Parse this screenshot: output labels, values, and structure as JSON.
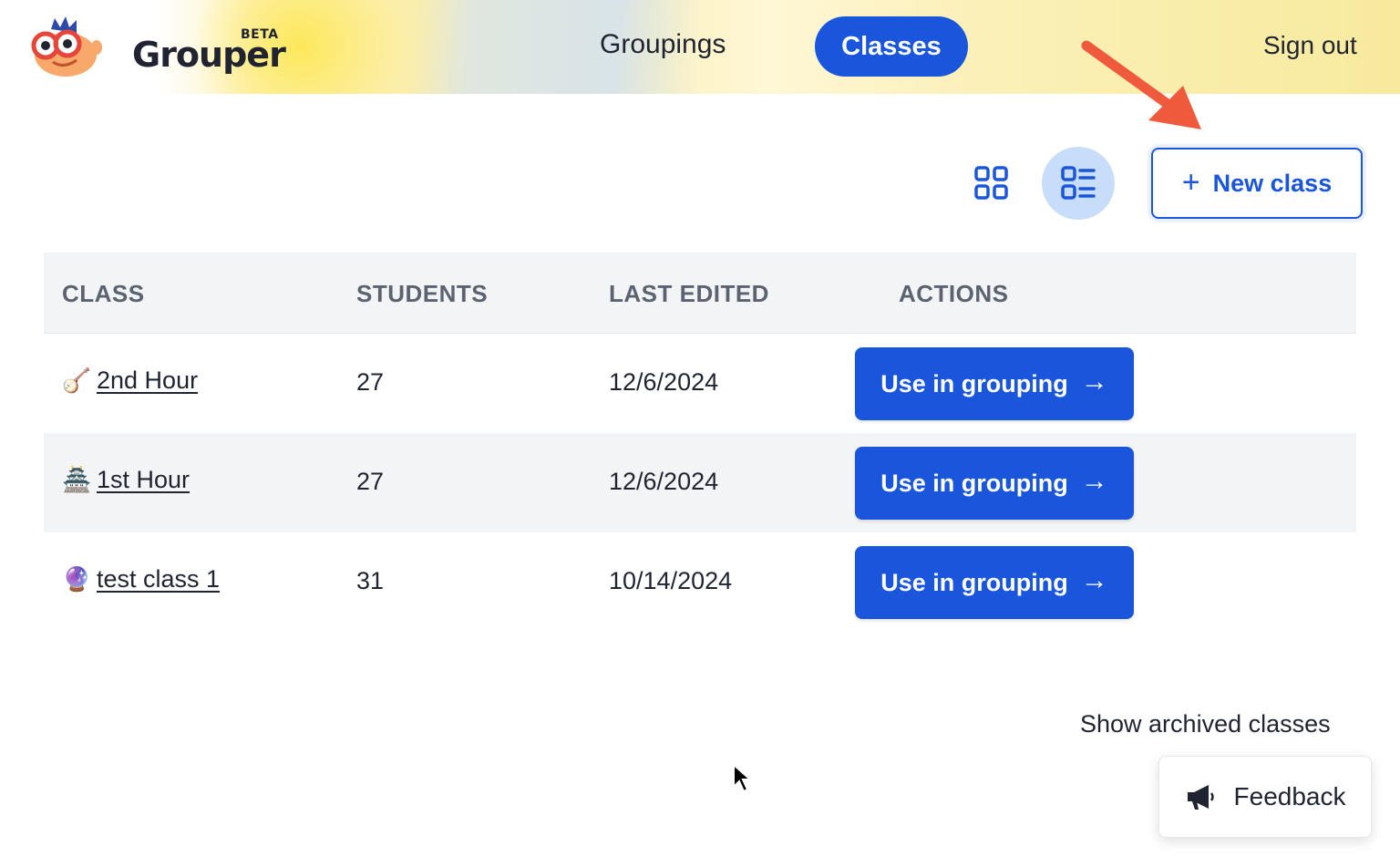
{
  "header": {
    "brand": "Grouper",
    "badge": "BETA",
    "nav": [
      {
        "label": "Groupings",
        "active": false
      },
      {
        "label": "Classes",
        "active": true
      }
    ],
    "sign_out_label": "Sign out"
  },
  "toolbar": {
    "grid_view_icon": "grid-icon",
    "list_view_icon": "list-icon",
    "active_view": "list",
    "new_class_label": "New class"
  },
  "table": {
    "headers": [
      "CLASS",
      "STUDENTS",
      "LAST EDITED",
      "ACTIONS"
    ],
    "rows": [
      {
        "emoji": "🪕",
        "name": "2nd Hour",
        "students": "27",
        "last_edited": "12/6/2024",
        "action_label": "Use in grouping"
      },
      {
        "emoji": "🏯",
        "name": "1st Hour",
        "students": "27",
        "last_edited": "12/6/2024",
        "action_label": "Use in grouping"
      },
      {
        "emoji": "🔮",
        "name": "test class 1",
        "students": "31",
        "last_edited": "10/14/2024",
        "action_label": "Use in grouping"
      }
    ]
  },
  "footer": {
    "show_archived_label": "Show archived classes",
    "feedback_label": "Feedback"
  },
  "colors": {
    "primary": "#1a56db",
    "active_view_bg": "#c8ddfa",
    "table_header_bg": "#f3f4f6",
    "annotation_arrow": "#f05a3c"
  }
}
